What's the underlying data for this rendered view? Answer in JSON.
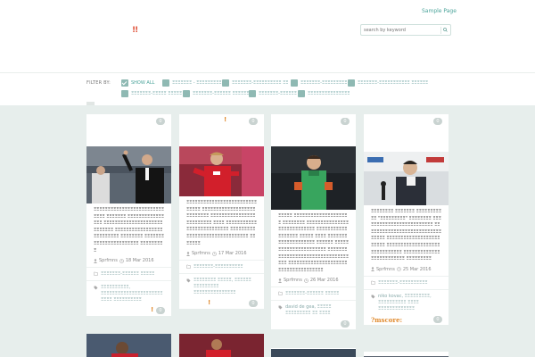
{
  "header": {
    "top_link": "Sample Page",
    "logo_mark": "!!",
    "search_placeholder": "search by keyword"
  },
  "filters": {
    "label": "FILTER BY:",
    "show_all": "SHOW ALL",
    "categories": [
      "ΞΞΞΞΞΞΞ - ΞΞΞΞΞΞΞΞΞΞ",
      "ΞΞΞΞΞΞΞ-ΞΞΞΞΞΞΞΞΞΞ ΞΞ",
      "ΞΞΞΞΞΞΞ-ΞΞΞΞΞΞΞΞΞ",
      "ΞΞΞΞΞΞΞ-ΞΞΞΞΞΞΞΞΞΞΞ ΞΞΞΞΞΞ",
      "ΞΞΞΞΞΞΞ-ΞΞΞΞΞ ΞΞΞΞΞ",
      "ΞΞΞΞΞΞΞ-ΞΞΞΞΞΞ ΞΞΞΞΞΞΞ",
      "ΞΞΞΞΞΞΞ-ΞΞΞΞΞΞ",
      "ΞΞΞΞΞΞΞΞΞΞΞΞΞΞΞ"
    ]
  },
  "cards": [
    {
      "bubble": "0",
      "text": "ΞΞΞΞΞΞΞΞΞΞΞΞΞΞΞΞΞΞΞΞΞΞΞΞΞΞΞΞΞ ΞΞΞΞΞΞΞ ΞΞΞΞΞΞΞΞΞΞΞΞΞΞΞΞ ΞΞΞΞΞΞΞΞΞΞΞΞΞΞΞΞΞΞΞΞΞΞΞΞΞΞΞΞ ΞΞΞΞΞΞΞΞΞΞΞΞΞΞΞΞΞΞΞΞΞΞΞΞΞΞ ΞΞΞΞΞΞΞΞ ΞΞΞΞΞΞΞΞΞΞΞΞΞΞΞΞΞΞΞΞΞΞΞ ΞΞΞΞΞΞΞΞΞ",
      "author": "Sprfmns",
      "date": "18 Mar 2016",
      "category": "ΞΞΞΞΞΞΞ-ΞΞΞΞΞΞ ΞΞΞΞΞ",
      "tags": "ΞΞΞΞΞΞΞΞΞΞ, ΞΞΞΞΞΞΞΞΞΞΞΞΞΞΞΞΞΞΞΞΞΞ ΞΞΞΞ ΞΞΞΞΞΞΞΞΞΞ",
      "bottom_bubble": "0"
    },
    {
      "bubble": "0",
      "text": "ΞΞΞΞΞΞΞΞΞΞΞΞΞΞΞΞΞΞΞΞΞΞΞΞΞ ΞΞΞΞΞ ΞΞΞΞΞΞΞΞΞΞΞΞΞΞΞΞΞΞΞΞΞΞΞΞΞΞΞ ΞΞΞΞΞΞΞΞΞΞΞΞΞΞΞΞΞΞΞΞΞΞΞΞΞ ΞΞΞΞ ΞΞΞΞΞΞΞΞΞΞΞΞΞΞΞΞΞΞΞΞΞΞΞΞΞΞ ΞΞΞΞΞΞΞΞΞΞΞΞΞΞΞΞΞΞΞΞΞΞΞΞΞΞΞΞΞΞΞ ΞΞΞΞΞΞΞ",
      "author": "Sprfmns",
      "date": "17 Mar 2016",
      "category": "ΞΞΞΞΞΞΞ-ΞΞΞΞΞΞΞΞΞΞ",
      "tags": "ΞΞΞΞΞΞΞΞ ΞΞΞΞΞ, ΞΞΞΞΞΞ ΞΞΞΞΞΞΞΞΞ ΞΞΞΞΞΞΞΞΞΞΞΞΞΞΞ",
      "bottom_bubble": "0"
    },
    {
      "bubble": "0",
      "text": "ΞΞΞΞΞ ΞΞΞΞΞΞΞΞΞΞΞΞΞΞΞΞΞΞΞΞ ΞΞΞΞΞΞΞΞ ΞΞΞΞΞΞΞΞΞΞΞΞΞΞΞΞΞΞΞΞΞΞΞΞΞΞΞΞ ΞΞΞΞΞΞΞΞΞΞΞΞΞΞΞΞΞΞ ΞΞΞΞΞ ΞΞΞΞ ΞΞΞΞΞΞΞΞΞΞΞΞΞΞΞΞΞΞΞΞ ΞΞΞΞΞΞ ΞΞΞΞΞ ΞΞΞΞΞΞΞΞΞΞΞΞΞΞΞΞΞ ΞΞΞΞΞΞΞΞΞΞΞΞΞΞΞΞΞΞΞΞΞΞΞΞΞΞΞΞΞΞΞΞΞΞΞ ΞΞΞΞΞΞΞΞΞΞΞΞΞΞΞΞΞΞΞΞΞΞΞΞΞΞΞΞΞΞΞΞΞΞΞΞΞ",
      "author": "Sprfmns",
      "date": "26 Mar 2016",
      "category": "ΞΞΞΞΞΞΞ-ΞΞΞΞΞΞ ΞΞΞΞΞ",
      "tags": "david de gea, ΞΞΞΞΞ ΞΞΞΞΞΞΞΞΞ ΞΞ ΞΞΞΞ",
      "bottom_bubble": "0"
    },
    {
      "bubble": "0",
      "text": "ΞΞΞΞΞΞΞΞ ΞΞΞΞΞΞΞ ΞΞΞΞΞΞΞΞΞ ΞΞ \"ΞΞΞΞΞΞΞΞΞ\" ΞΞΞΞΞΞΞΞ ΞΞΞΞΞΞΞΞΞΞΞΞΞΞΞΞΞΞΞΞΞΞΞΞΞ ΞΞΞΞΞΞΞΞΞΞΞΞΞΞΞΞΞΞΞΞΞΞΞΞΞΞΞ ΞΞΞΞΞ ΞΞΞΞΞΞΞΞΞΞΞΞΞΞΞΞΞΞΞΞΞΞΞΞ ΞΞΞΞΞΞΞΞΞΞΞΞΞΞΞΞΞΞΞΞΞΞΞΞΞΞΞΞΞΞ ΞΞΞΞΞΞΞΞΞΞΞΞΞΞΞΞΞΞΞΞΞΞΞΞΞ ΞΞΞΞΞΞΞΞΞ",
      "author": "Sprfmns",
      "date": "25 Mar 2016",
      "category": "ΞΞΞΞΞΞΞ-ΞΞΞΞΞΞΞΞΞΞ",
      "tags": "niko kovac, ΞΞΞΞΞΞΞΞΞ, ΞΞΞΞΞΞΞΞΞΞ ΞΞΞΞ ΞΞΞΞΞΞΞΞΞΞΞΞΞ",
      "score_label": "?mscore:",
      "bottom_bubble": "0"
    }
  ]
}
